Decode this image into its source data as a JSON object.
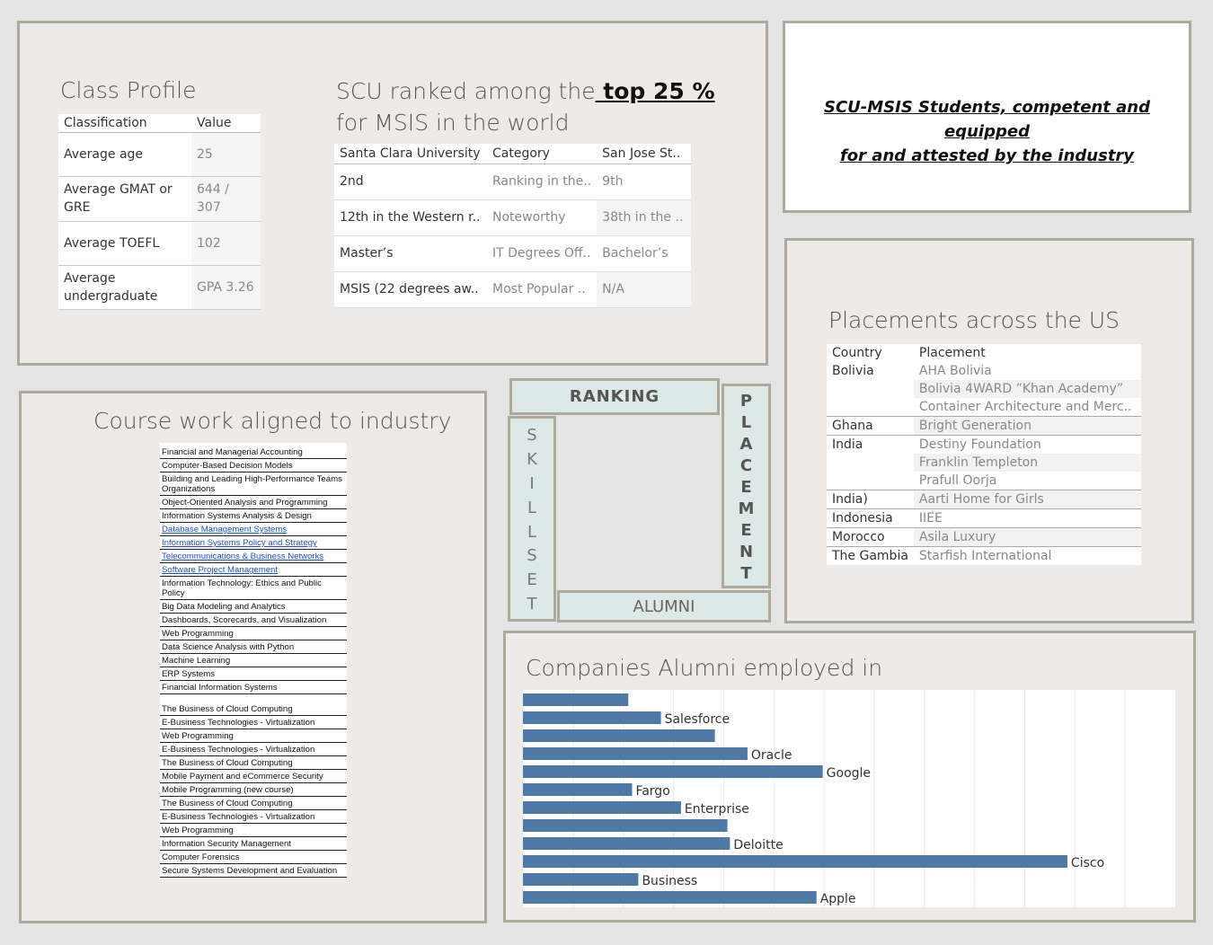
{
  "class_profile": {
    "title": "Class Profile",
    "columns": [
      "Classification",
      "Value"
    ],
    "rows": [
      {
        "label": "Average age",
        "value": "25"
      },
      {
        "label": "Average GMAT or GRE",
        "value": "644 / 307"
      },
      {
        "label": "Average TOEFL",
        "value": "102"
      },
      {
        "label": "Average undergraduate",
        "value": "GPA 3.26"
      }
    ]
  },
  "ranking": {
    "title_prefix": "SCU ranked among the",
    "title_link": " top 25 %",
    "title_suffix": "for MSIS in the world",
    "columns": [
      "Santa Clara University",
      "Category",
      "San Jose St.."
    ],
    "rows": [
      {
        "scu": "2nd",
        "category": "Ranking in the..",
        "sjsu": "9th"
      },
      {
        "scu": "12th in the Western r..",
        "category": "Noteworthy",
        "sjsu": "38th in the .."
      },
      {
        "scu": "Master’s",
        "category": "IT Degrees Off..",
        "sjsu": "Bachelor’s"
      },
      {
        "scu": "MSIS (22 degrees aw..",
        "category": "Most Popular ..",
        "sjsu": "N/A"
      }
    ]
  },
  "banner": {
    "line1": "SCU-MSIS Students, competent and equipped",
    "line2": "for and attested by the industry"
  },
  "placements": {
    "title": "Placements across the US",
    "columns": [
      "Country",
      "Placement"
    ],
    "groups": [
      {
        "country": "Bolivia",
        "items": [
          "AHA Bolivia",
          "Bolivia 4WARD ”Khan Academy”",
          "Container Architecture and Merc.."
        ]
      },
      {
        "country": "Ghana",
        "items": [
          "Bright Generation"
        ]
      },
      {
        "country": "India",
        "items": [
          "Destiny Foundation",
          "Franklin Templeton",
          "Prafull Oorja"
        ]
      },
      {
        "country": "India)",
        "items": [
          "Aarti Home for Girls"
        ]
      },
      {
        "country": "Indonesia",
        "items": [
          "IIEE"
        ]
      },
      {
        "country": "Morocco",
        "items": [
          "Asila Luxury"
        ]
      },
      {
        "country": "The Gambia",
        "items": [
          "Starfish International"
        ]
      }
    ]
  },
  "coursework": {
    "title": "Course work aligned to industry",
    "items": [
      {
        "text": "Financial and Managerial Accounting",
        "link": false
      },
      {
        "text": "Computer-Based Decision Models",
        "link": false
      },
      {
        "text": "Building and Leading High-Performance Teams Organizations",
        "link": false
      },
      {
        "text": "Object-Oriented Analysis and Programming",
        "link": false
      },
      {
        "text": "Information Systems Analysis & Design",
        "link": false
      },
      {
        "text": "Database Management Systems",
        "link": true
      },
      {
        "text": "Information Systems Policy and Strategy",
        "link": true
      },
      {
        "text": "Telecommunications & Business Networks",
        "link": true
      },
      {
        "text": "Software Project Management",
        "link": true
      },
      {
        "text": "Information Technology: Ethics and Public Policy",
        "link": false
      },
      {
        "text": "Big Data Modeling and Analytics",
        "link": false
      },
      {
        "text": "Dashboards, Scorecards, and Visualization",
        "link": false
      },
      {
        "text": "Web Programming",
        "link": false
      },
      {
        "text": "Data Science Analysis with Python",
        "link": false
      },
      {
        "text": "Machine Learning",
        "link": false
      },
      {
        "text": "ERP Systems",
        "link": false
      },
      {
        "text": "Financial Information Systems",
        "link": false
      },
      {
        "text": "The Business of Cloud Computing",
        "link": false,
        "gap": true
      },
      {
        "text": "E-Business Technologies - Virtualization",
        "link": false
      },
      {
        "text": "Web Programming",
        "link": false
      },
      {
        "text": "E-Business Technologies - Virtualization",
        "link": false
      },
      {
        "text": "The Business of Cloud Computing",
        "link": false
      },
      {
        "text": "Mobile Payment and eCommerce Security",
        "link": false
      },
      {
        "text": "Mobile Programming (new course)",
        "link": false
      },
      {
        "text": "The Business of Cloud Computing",
        "link": false
      },
      {
        "text": "E-Business Technologies - Virtualization",
        "link": false
      },
      {
        "text": "Web Programming",
        "link": false
      },
      {
        "text": "Information Security Management",
        "link": false
      },
      {
        "text": "Computer Forensics",
        "link": false
      },
      {
        "text": "Secure Systems Development and Evaluation",
        "link": false
      }
    ]
  },
  "nav": {
    "ranking": "RANKING",
    "alumni": "ALUMNI",
    "placement": [
      "P",
      "L",
      "A",
      "C",
      "E",
      "M",
      "E",
      "N",
      "T"
    ],
    "skillset": [
      "S",
      "K",
      "I",
      "L",
      "L",
      "S",
      "E",
      "T"
    ]
  },
  "companies": {
    "title": "Companies Alumni employed in"
  },
  "chart_data": {
    "type": "bar",
    "orientation": "horizontal",
    "categories": [
      "",
      "Salesforce",
      "",
      "Oracle",
      "Google",
      "Fargo",
      "Enterprise",
      "",
      "Deloitte",
      "Cisco",
      "Business",
      "Apple"
    ],
    "values": [
      8.4,
      11.0,
      15.3,
      17.9,
      23.9,
      8.7,
      12.6,
      16.3,
      16.5,
      43.4,
      9.2,
      23.4
    ],
    "xlim": [
      0,
      52
    ],
    "grid": true,
    "bar_color": "#4e79a7"
  }
}
